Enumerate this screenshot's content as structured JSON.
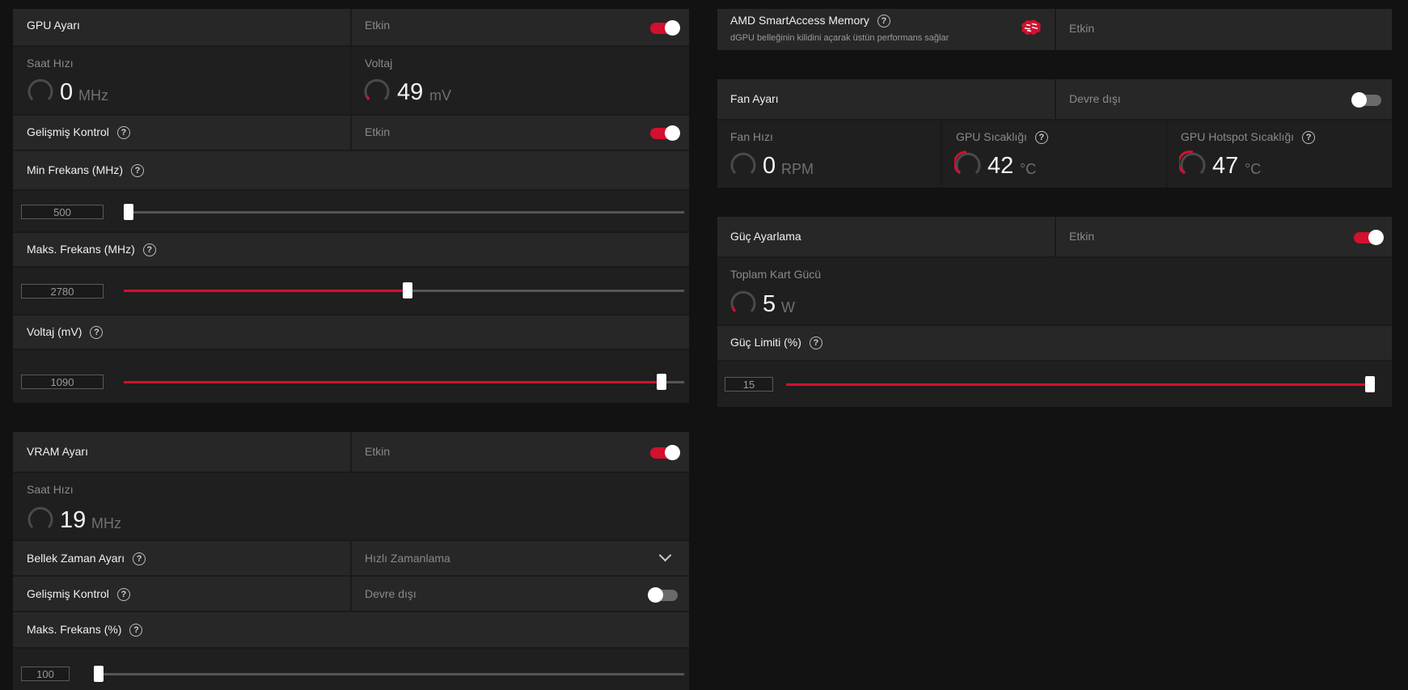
{
  "colors": {
    "accent": "#d2102f",
    "card": "#232323",
    "background": "#121212"
  },
  "gpu": {
    "title": "GPU Ayarı",
    "status": "Etkin",
    "toggle_on": true,
    "clock": {
      "label": "Saat Hızı",
      "value": "0",
      "unit": "MHz"
    },
    "voltage": {
      "label": "Voltaj",
      "value": "49",
      "unit": "mV"
    },
    "advanced": {
      "label": "Gelişmiş Kontrol",
      "status": "Etkin",
      "toggle_on": true
    },
    "min_freq": {
      "label": "Min Frekans (MHz)",
      "value": "500",
      "fraction": 0.0
    },
    "max_freq": {
      "label": "Maks. Frekans (MHz)",
      "value": "2780",
      "fraction": 0.506
    },
    "volt_slider": {
      "label": "Voltaj (mV)",
      "value": "1090",
      "fraction": 0.968
    }
  },
  "vram": {
    "title": "VRAM Ayarı",
    "status": "Etkin",
    "toggle_on": true,
    "clock": {
      "label": "Saat Hızı",
      "value": "19",
      "unit": "MHz"
    },
    "memory_timing": {
      "label": "Bellek Zaman Ayarı",
      "selected": "Hızlı Zamanlama"
    },
    "advanced": {
      "label": "Gelişmiş Kontrol",
      "status": "Devre dışı",
      "toggle_on": false
    },
    "max_freq": {
      "label": "Maks. Frekans (%)",
      "value": "100",
      "fraction": 0.0
    }
  },
  "sam": {
    "title": "AMD SmartAccess Memory",
    "description": "dGPU belleğinin kilidini açarak üstün performans sağlar",
    "status": "Etkin"
  },
  "fan": {
    "title": "Fan Ayarı",
    "status": "Devre dışı",
    "toggle_on": false,
    "speed": {
      "label": "Fan Hızı",
      "value": "0",
      "unit": "RPM"
    },
    "gpu_temp": {
      "label": "GPU Sıcaklığı",
      "value": "42",
      "unit": "°C"
    },
    "hotspot_temp": {
      "label": "GPU Hotspot Sıcaklığı",
      "value": "47",
      "unit": "°C"
    }
  },
  "power": {
    "title": "Güç Ayarlama",
    "status": "Etkin",
    "toggle_on": true,
    "total": {
      "label": "Toplam Kart Gücü",
      "value": "5",
      "unit": "W"
    },
    "limit": {
      "label": "Güç Limiti (%)",
      "value": "15",
      "fraction": 1.0
    }
  }
}
